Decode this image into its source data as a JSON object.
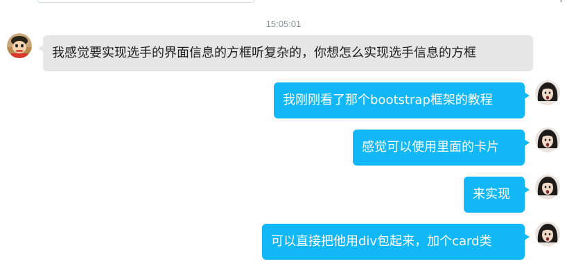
{
  "timestamp": "15:05:01",
  "messages": [
    {
      "side": "in",
      "text": "我感觉要实现选手的界面信息的方框听复杂的，你想怎么实现选手信息的方框"
    },
    {
      "side": "out",
      "text": "我刚刚看了那个bootstrap框架的教程"
    },
    {
      "side": "out",
      "text": "感觉可以使用里面的卡片"
    },
    {
      "side": "out",
      "text": "来实现"
    },
    {
      "side": "out",
      "text": "可以直接把他用div包起来，加个card类"
    }
  ],
  "colors": {
    "incoming_bubble": "#e6e6e7",
    "outgoing_bubble": "#12b7f5",
    "incoming_text": "#1d1d1d",
    "outgoing_text": "#ffffff",
    "timestamp": "#8a8f96"
  },
  "icons": {
    "incoming_avatar": "cartoon-boy-avatar",
    "outgoing_avatar": "girl-photo-avatar",
    "corner": "resize-icon"
  }
}
